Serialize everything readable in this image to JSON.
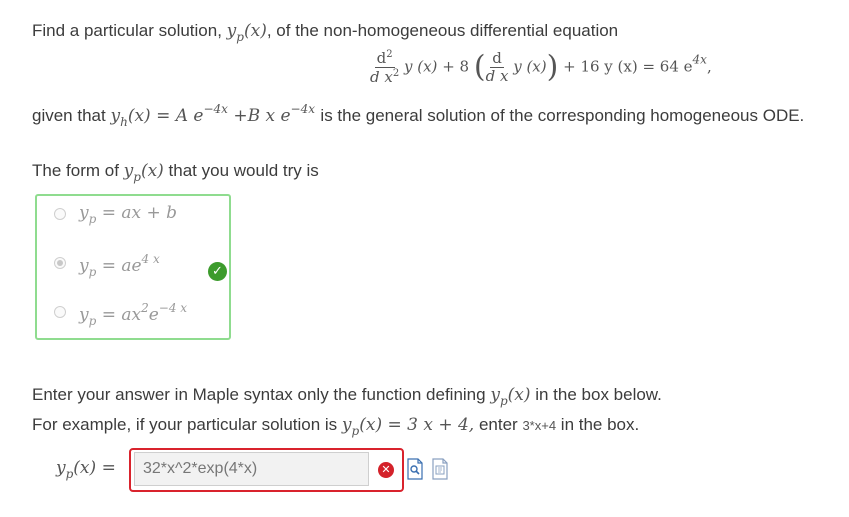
{
  "question": {
    "line1": "Find a particular solution,",
    "line1_comma": ",",
    "line1_end": "of the non-homogeneous differential equation",
    "yp_sym": "y",
    "p_sub": "p",
    "x_arg": "(x)",
    "h_sub": "h",
    "eq": {
      "d2": "d",
      "two": "2",
      "dx2": "d x",
      "y_x": "y (x)",
      "plus8": "+ 8",
      "d1": "d",
      "dx": "d x",
      "rest": "+ 16 y (x) = 64 e",
      "exp": "4x",
      "end": ","
    },
    "given_pre": "given that",
    "given_eq": "= A e",
    "given_exp1": "−4x",
    "given_mid": "+B x e",
    "given_exp2": "−4x",
    "given_post": "is the general solution of the corresponding homogeneous ODE."
  },
  "form": {
    "prompt_pre": "The form of",
    "prompt_post": "that you would try is"
  },
  "options": [
    {
      "lhs": "y",
      "sub": "p",
      "rhs": "= ax + b",
      "exp": "",
      "tail": "",
      "exp2": "",
      "selected": false
    },
    {
      "lhs": "y",
      "sub": "p",
      "rhs": "= ae",
      "exp": "4 x",
      "tail": "",
      "exp2": "",
      "selected": true
    },
    {
      "lhs": "y",
      "sub": "p",
      "rhs": "= ax",
      "exp": "2",
      "tail": "e",
      "exp2": "−4 x",
      "selected": false
    }
  ],
  "instructions": {
    "line1_pre": "Enter your answer in Maple syntax only the function defining",
    "line1_post": "in the box below.",
    "line2_pre": "For example, if your particular solution is",
    "line2_eq": "= 3 x + 4,",
    "line2_mid": "enter",
    "line2_code": "3*x+4",
    "line2_post": "in the box."
  },
  "answer": {
    "label_eq": "=",
    "value": "32*x^2*exp(4*x)",
    "status": "incorrect"
  },
  "colors": {
    "correct": "#3c9b2c",
    "incorrect": "#d9232d",
    "options_border": "#8fdc8f"
  }
}
